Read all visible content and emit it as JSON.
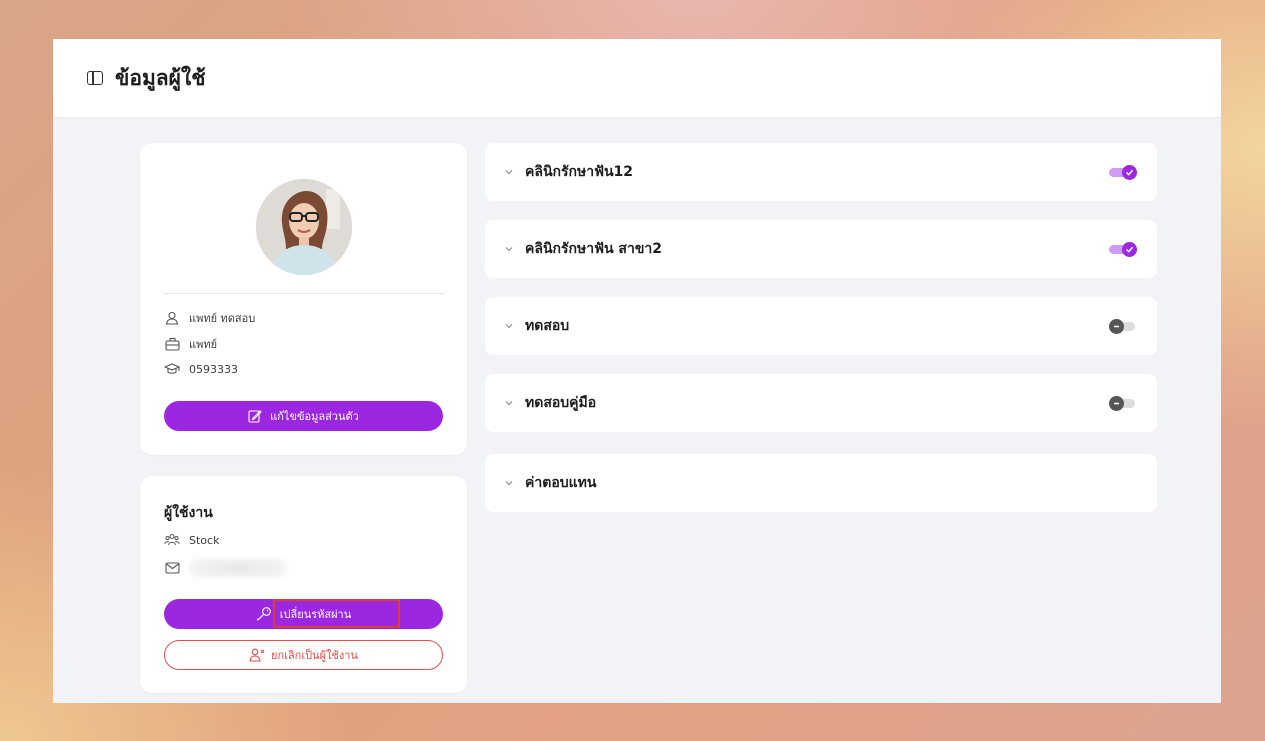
{
  "page": {
    "title": "ข้อมูลผู้ใช้"
  },
  "profile": {
    "name": "แพทย์ ทดสอบ",
    "role": "แพทย์",
    "license": "0593333",
    "edit_button_label": "แก้ไขข้อมูลส่วนตัว"
  },
  "user": {
    "title": "ผู้ใช้งาน",
    "group": "Stock",
    "change_password_label": "เปลี่ยนรหัสผ่าน",
    "remove_user_label": "ยกเลิกเป็นผู้ใช้งาน"
  },
  "accordions": [
    {
      "title": "คลินิกรักษาฟัน12",
      "toggle": "on"
    },
    {
      "title": "คลินิกรักษาฟัน สาขา2",
      "toggle": "on"
    },
    {
      "title": "ทดสอบ",
      "toggle": "off"
    },
    {
      "title": "ทดสอบคู่มือ",
      "toggle": "off"
    },
    {
      "title": "ค่าตอบแทน",
      "toggle": "none"
    }
  ],
  "colors": {
    "accent": "#9b27e0",
    "danger": "#e04a4a",
    "highlight": "#e03b35"
  }
}
